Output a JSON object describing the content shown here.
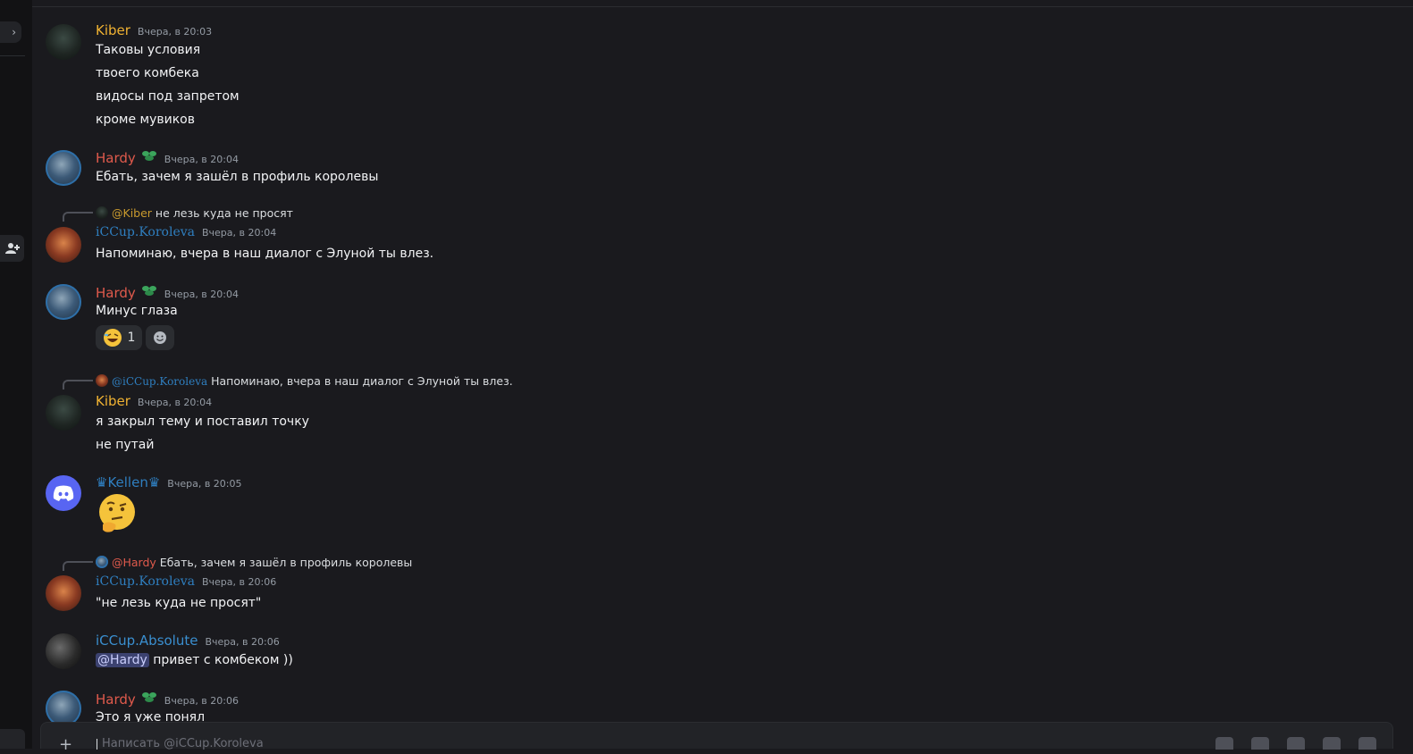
{
  "rail": {
    "chevron_icon": "chevron-right-icon",
    "add_friend_icon": "add-friend-icon"
  },
  "messages": [
    {
      "author": "Kiber",
      "author_color": "#f0b232",
      "time": "Вчера, в 20:03",
      "lines": [
        "Таковы условия",
        "твоего комбека",
        "видосы под запретом",
        "кроме мувиков"
      ]
    },
    {
      "author": "Hardy",
      "author_color": "#e05a4c",
      "time": "Вчера, в 20:04",
      "badge_icon": "leaf-badge-icon",
      "lines": [
        "Ебать, зачем я зашёл в профиль королевы"
      ]
    },
    {
      "reply_to": "@Kiber",
      "reply_color": "#c99a2e",
      "reply_text": "не лезь куда не просят",
      "author": "iCCup.Koroleva",
      "author_color": "#2f7fc0",
      "time": "Вчера, в 20:04",
      "lines": [
        "Напоминаю, вчера в наш диалог с Элуной ты влез."
      ]
    },
    {
      "author": "Hardy",
      "author_color": "#e05a4c",
      "time": "Вчера, в 20:04",
      "badge_icon": "leaf-badge-icon",
      "lines": [
        "Минус глаза"
      ],
      "reaction": {
        "emoji": "rolling-laughing-emoji",
        "count": "1"
      },
      "add_reaction_icon": "add-reaction-icon"
    },
    {
      "reply_to": "@iCCup.Koroleva",
      "reply_color": "#2f7fc0",
      "reply_text": "Напоминаю, вчера в наш диалог с Элуной ты влез.",
      "author": "Kiber",
      "author_color": "#f0b232",
      "time": "Вчера, в 20:04",
      "lines": [
        "я закрыл тему и поставил точку",
        "не путай"
      ]
    },
    {
      "author": "♛Kellen♛",
      "author_color": "#2f7fc0",
      "time": "Вчера, в 20:05",
      "emoji": "thinking-face-emoji",
      "avatar_icon": "discord-logo-icon"
    },
    {
      "reply_to": "@Hardy",
      "reply_color": "#e05a4c",
      "reply_text": "Ебать, зачем я зашёл в профиль королевы",
      "author": "iCCup.Koroleva",
      "author_color": "#2f7fc0",
      "time": "Вчера, в 20:06",
      "lines": [
        "\"не лезь куда не просят\""
      ]
    },
    {
      "author": "iCCup.Absolute",
      "author_color": "#3a8fd0",
      "time": "Вчера, в 20:06",
      "mention": "@Hardy",
      "lines": [
        "привет с комбеком ))"
      ]
    },
    {
      "author": "Hardy",
      "author_color": "#e05a4c",
      "time": "Вчера, в 20:06",
      "badge_icon": "leaf-badge-icon",
      "lines": [
        "Это я уже понял"
      ]
    }
  ],
  "composer": {
    "placeholder": "Написать @iCCup.Koroleva",
    "plus_icon": "plus-circle-icon"
  }
}
